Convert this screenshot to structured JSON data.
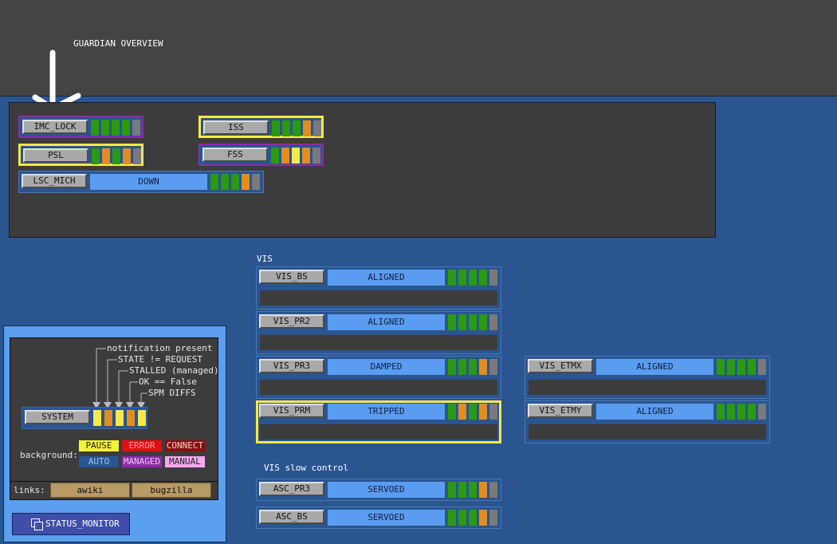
{
  "header": {
    "title": "GUARDIAN OVERVIEW"
  },
  "colors": {
    "ok": "#2a9a10",
    "warn": "#e08e20",
    "notify": "#f6e94a",
    "off": "#7a7a7a",
    "state": "#5a9cf0"
  },
  "top_nodes": [
    {
      "name": "IMC_LOCK",
      "ind": [
        "ok",
        "ok",
        "ok",
        "ok",
        "off"
      ]
    },
    {
      "name": "PSL",
      "ind": [
        "ok",
        "warn",
        "ok",
        "warn",
        "off"
      ]
    },
    {
      "name": "LSC_MICH",
      "state": "DOWN",
      "ind": [
        "ok",
        "ok",
        "ok",
        "warn",
        "off"
      ]
    },
    {
      "name": "ISS",
      "ind": [
        "ok",
        "ok",
        "ok",
        "warn",
        "off"
      ]
    },
    {
      "name": "FSS",
      "ind": [
        "ok",
        "warn",
        "notify",
        "warn",
        "off"
      ]
    }
  ],
  "vis": {
    "label": "VIS",
    "nodes": [
      {
        "name": "VIS_BS",
        "state": "ALIGNED",
        "ind": [
          "ok",
          "ok",
          "ok",
          "ok",
          "off"
        ]
      },
      {
        "name": "VIS_PR2",
        "state": "ALIGNED",
        "ind": [
          "ok",
          "ok",
          "ok",
          "ok",
          "off"
        ]
      },
      {
        "name": "VIS_PR3",
        "state": "DAMPED",
        "ind": [
          "ok",
          "ok",
          "ok",
          "warn",
          "off"
        ]
      },
      {
        "name": "VIS_PRM",
        "state": "TRIPPED",
        "ind": [
          "ok",
          "warn",
          "ok",
          "warn",
          "off"
        ]
      },
      {
        "name": "VIS_ETMX",
        "state": "ALIGNED",
        "ind": [
          "ok",
          "ok",
          "ok",
          "ok",
          "off"
        ]
      },
      {
        "name": "VIS_ETMY",
        "state": "ALIGNED",
        "ind": [
          "ok",
          "ok",
          "ok",
          "ok",
          "off"
        ]
      }
    ]
  },
  "slow": {
    "label": "VIS slow control",
    "nodes": [
      {
        "name": "ASC_PR3",
        "state": "SERVOED",
        "ind": [
          "ok",
          "ok",
          "ok",
          "warn",
          "off"
        ]
      },
      {
        "name": "ASC_BS",
        "state": "SERVOED",
        "ind": [
          "ok",
          "ok",
          "ok",
          "warn",
          "off"
        ]
      }
    ]
  },
  "legend": {
    "notes": [
      "notification present",
      "STATE != REQUEST",
      "STALLED (managed)",
      "OK == False",
      "SPM DIFFS"
    ],
    "system_label": "SYSTEM",
    "system_ind": [
      "notify",
      "warn",
      "notify",
      "warn",
      "notify"
    ],
    "background_label": "background:",
    "chips": [
      {
        "text": "PAUSE",
        "bg": "#f6f23a",
        "fg": "#202020"
      },
      {
        "text": "ERROR",
        "bg": "#e01010",
        "fg": "#f0a0a0"
      },
      {
        "text": "CONNECT",
        "bg": "#8a1010",
        "fg": "#f0d0d0"
      },
      {
        "text": "AUTO",
        "bg": "#2a5590",
        "fg": "#a8c4ec"
      },
      {
        "text": "MANAGED",
        "bg": "#8e2aa8",
        "fg": "#e8c8f0"
      },
      {
        "text": "MANUAL",
        "bg": "#f4a8f0",
        "fg": "#202020"
      }
    ],
    "links_label": "links:",
    "links": [
      "awiki",
      "bugzilla"
    ],
    "status_monitor": "STATUS_MONITOR"
  }
}
